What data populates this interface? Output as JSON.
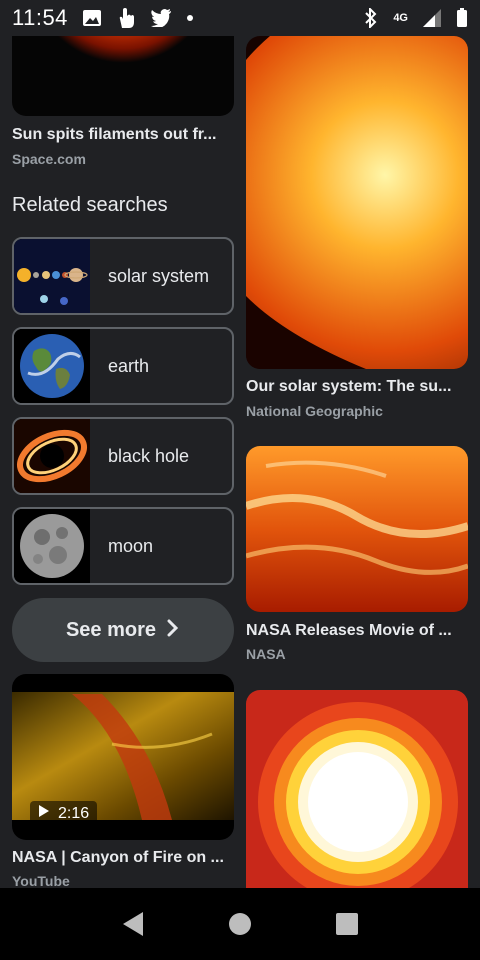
{
  "status_bar": {
    "time": "11:54",
    "network": "4G",
    "icons": [
      "image-icon",
      "hand-icon",
      "twitter-icon",
      "dot-icon",
      "bluetooth-icon",
      "network-4g-icon",
      "signal-icon",
      "battery-icon"
    ]
  },
  "results_left": {
    "card_top": {
      "title": "Sun spits filaments out fr...",
      "source": "Space.com"
    },
    "related_heading": "Related searches",
    "related_items": [
      {
        "label": "solar system",
        "icon": "solar-system-thumbnail"
      },
      {
        "label": "earth",
        "icon": "earth-thumbnail"
      },
      {
        "label": "black hole",
        "icon": "black-hole-thumbnail"
      },
      {
        "label": "moon",
        "icon": "moon-thumbnail"
      }
    ],
    "see_more_label": "See more",
    "video_card": {
      "title": "NASA | Canyon of Fire on ...",
      "source": "YouTube",
      "duration": "2:16"
    }
  },
  "results_right": {
    "cards": [
      {
        "title": "Our solar system: The su...",
        "source": "National Geographic"
      },
      {
        "title": "NASA Releases Movie of ...",
        "source": "NASA"
      }
    ]
  },
  "colors": {
    "background": "#202124",
    "text_primary": "#e8eaed",
    "text_secondary": "#9aa0a6",
    "border": "#5f6368",
    "button_bg": "#3c4043"
  }
}
